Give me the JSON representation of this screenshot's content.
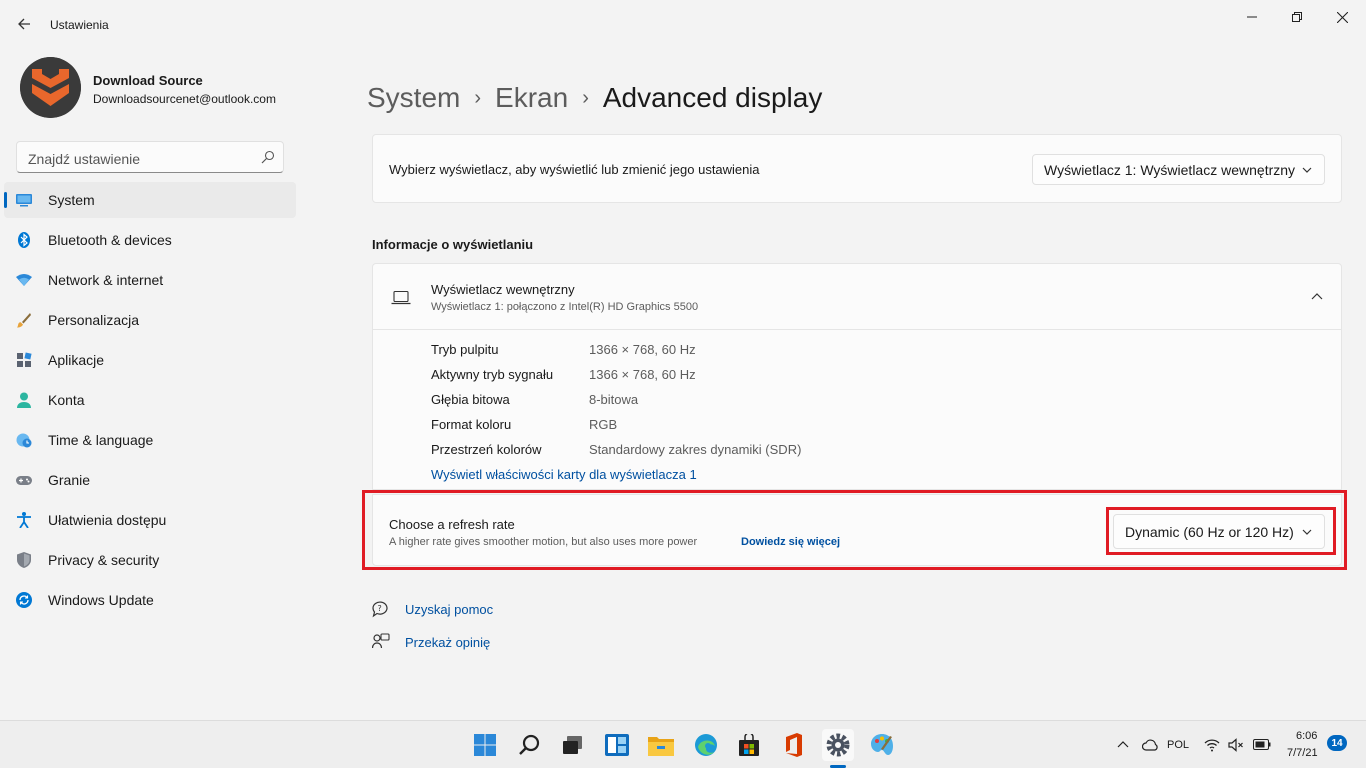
{
  "window": {
    "title": "Ustawienia",
    "back_icon": "back-arrow-icon",
    "minimize_icon": "minimize-icon",
    "maximize_icon": "maximize-icon",
    "close_icon": "close-icon"
  },
  "profile": {
    "name": "Download Source",
    "email": "Downloadsourcenet@outlook.com"
  },
  "search": {
    "placeholder": "Znajdź ustawienie"
  },
  "sidebar": {
    "items": [
      {
        "label": "System",
        "icon": "monitor-icon",
        "active": true
      },
      {
        "label": "Bluetooth & devices",
        "icon": "bluetooth-icon"
      },
      {
        "label": "Network & internet",
        "icon": "wifi-icon"
      },
      {
        "label": "Personalizacja",
        "icon": "brush-icon"
      },
      {
        "label": "Aplikacje",
        "icon": "apps-icon"
      },
      {
        "label": "Konta",
        "icon": "person-icon"
      },
      {
        "label": "Time & language",
        "icon": "globe-clock-icon"
      },
      {
        "label": "Granie",
        "icon": "gamepad-icon"
      },
      {
        "label": "Ułatwienia dostępu",
        "icon": "accessibility-icon"
      },
      {
        "label": "Privacy & security",
        "icon": "shield-icon"
      },
      {
        "label": "Windows Update",
        "icon": "update-icon"
      }
    ]
  },
  "breadcrumb": {
    "parts": [
      "System",
      "Ekran"
    ],
    "current": "Advanced display"
  },
  "display_select": {
    "label": "Wybierz wyświetlacz, aby wyświetlić lub zmienić jego ustawienia",
    "value": "Wyświetlacz 1: Wyświetlacz wewnętrzny"
  },
  "display_info": {
    "section_title": "Informacje o wyświetlaniu",
    "title": "Wyświetlacz wewnętrzny",
    "subtitle": "Wyświetlacz 1: połączono z Intel(R) HD Graphics 5500",
    "rows": [
      {
        "key": "Tryb pulpitu",
        "value": "1366 × 768, 60 Hz"
      },
      {
        "key": "Aktywny tryb sygnału",
        "value": "1366 × 768, 60 Hz"
      },
      {
        "key": "Głębia bitowa",
        "value": "8-bitowa"
      },
      {
        "key": "Format koloru",
        "value": "RGB"
      },
      {
        "key": "Przestrzeń kolorów",
        "value": "Standardowy zakres dynamiki (SDR)"
      }
    ],
    "adapter_link": "Wyświetl właściwości karty dla wyświetlacza 1"
  },
  "refresh_rate": {
    "title": "Choose a refresh rate",
    "description": "A higher rate gives smoother motion, but also uses more power",
    "learn_more": "Dowiedz się więcej",
    "value": "Dynamic (60 Hz or 120 Hz)"
  },
  "help": {
    "get_help": "Uzyskaj pomoc",
    "feedback": "Przekaż opinię"
  },
  "taskbar": {
    "language": "POL",
    "time": "6:06",
    "date": "7/7/21",
    "notifications": "14"
  },
  "colors": {
    "accent": "#0067c0",
    "highlight_border": "#e01b24",
    "link": "#0050a0"
  }
}
